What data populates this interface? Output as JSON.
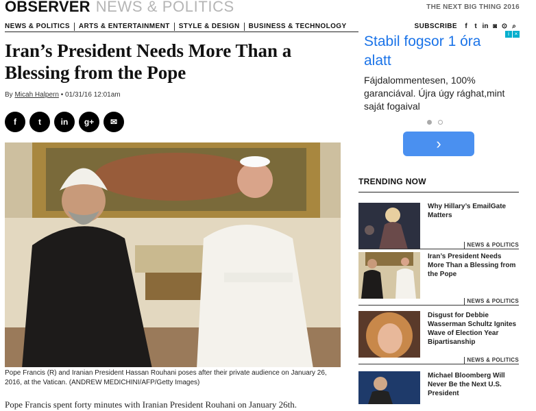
{
  "masthead": {
    "brand": "OBSERVER",
    "section": "NEWS & POLITICS",
    "tagline": "THE NEXT BIG THING 2016"
  },
  "nav": {
    "items": [
      "NEWS & POLITICS",
      "ARTS & ENTERTAINMENT",
      "STYLE & DESIGN",
      "BUSINESS & TECHNOLOGY"
    ],
    "subscribe": "SUBSCRIBE",
    "social": [
      {
        "icon": "facebook-icon",
        "glyph": "f"
      },
      {
        "icon": "twitter-icon",
        "glyph": "t"
      },
      {
        "icon": "linkedin-icon",
        "glyph": "in"
      },
      {
        "icon": "instagram-icon",
        "glyph": "◙"
      },
      {
        "icon": "rss-icon",
        "glyph": "⊙"
      },
      {
        "icon": "search-icon",
        "glyph": "⌕"
      }
    ]
  },
  "article": {
    "headline": "Iran’s President Needs More Than a Blessing from the Pope",
    "byline_prefix": "By",
    "author": "Micah Halpern",
    "timestamp": "• 01/31/16 12:01am",
    "share": [
      {
        "icon": "facebook-icon",
        "glyph": "f"
      },
      {
        "icon": "twitter-icon",
        "glyph": "t"
      },
      {
        "icon": "linkedin-icon",
        "glyph": "in"
      },
      {
        "icon": "googleplus-icon",
        "glyph": "g+"
      },
      {
        "icon": "email-icon",
        "glyph": "✉"
      }
    ],
    "caption": "Pope Francis (R) and Iranian President Hassan Rouhani poses after their private audience on January 26, 2016, at the Vatican. (ANDREW MEDICHINI/AFP/Getty Images)",
    "body_first_line": "Pope Francis spent forty minutes with Iranian President Rouhani on January 26th."
  },
  "ad": {
    "title": "Stabil fogsor 1 óra alatt",
    "description": "Fájdalommentesen, 100% garanciával. Újra úgy rághat,mint saját fogaival",
    "cta_glyph": "›",
    "accent": "#1a73e8",
    "button_color": "#4a90f0"
  },
  "trending": {
    "header": "TRENDING NOW",
    "items": [
      {
        "title": "Why Hillary’s EmailGate Matters",
        "tag": "NEWS & POLITICS"
      },
      {
        "title": "Iran’s President Needs More Than a Blessing from the Pope",
        "tag": "NEWS & POLITICS"
      },
      {
        "title": "Disgust for Debbie Wasserman Schultz Ignites Wave of Election Year Bipartisanship",
        "tag": "NEWS & POLITICS"
      },
      {
        "title": "Michael Bloomberg Will Never Be the Next U.S. President",
        "tag": ""
      }
    ]
  }
}
